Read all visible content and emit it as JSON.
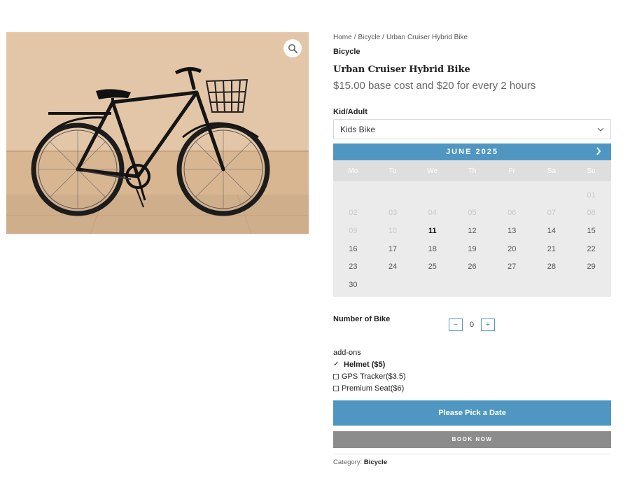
{
  "product": {
    "breadcrumb": [
      "Home",
      "Bicycle",
      "Urban Cruiser Hybrid Bike"
    ],
    "breadcrumb_separator": "/",
    "category_top": "Bicycle",
    "title": "Urban Cruiser Hybrid Bike",
    "price_text": "$15.00 base cost and $20 for every 2 hours",
    "image_alt_icon": "bicycle-photo",
    "zoom_icon": "magnifier-icon"
  },
  "type_field": {
    "label": "Kid/Adult",
    "selected": "Kids Bike"
  },
  "calendar": {
    "month": "JUNE 2025",
    "weekdays": [
      "Mo",
      "Tu",
      "We",
      "Th",
      "Fr",
      "Sa",
      "Su"
    ],
    "weeks": [
      [
        "",
        "",
        "",
        "",
        "",
        "",
        "01"
      ],
      [
        "02",
        "03",
        "04",
        "05",
        "06",
        "07",
        "08"
      ],
      [
        "09",
        "10",
        "11",
        "12",
        "13",
        "14",
        "15"
      ],
      [
        "16",
        "17",
        "18",
        "19",
        "20",
        "21",
        "22"
      ],
      [
        "23",
        "24",
        "25",
        "26",
        "27",
        "28",
        "29"
      ],
      [
        "30",
        "",
        "",
        "",
        "",
        "",
        ""
      ]
    ],
    "disabled_days": [
      "01",
      "02",
      "03",
      "04",
      "05",
      "06",
      "07",
      "08",
      "09",
      "10"
    ],
    "today": "11",
    "header_color": "#4f97c2"
  },
  "quantity": {
    "label": "Number of Bike",
    "value": "0",
    "minus": "−",
    "plus": "+"
  },
  "addons": {
    "title": "add-ons",
    "items": [
      {
        "label": "Helmet ($5)",
        "checked": true
      },
      {
        "label": "GPS Tracker($3.5)",
        "checked": false
      },
      {
        "label": "Premium Seat($6)",
        "checked": false
      }
    ]
  },
  "buttons": {
    "pick_date": "Please Pick a Date",
    "book_now": "BOOK NOW"
  },
  "meta": {
    "category_label": "Category:",
    "category_value": "Bicycle"
  },
  "colors": {
    "accent": "#4f97c2",
    "book_button": "#8c8c8c",
    "calendar_bg": "#ebebeb"
  }
}
